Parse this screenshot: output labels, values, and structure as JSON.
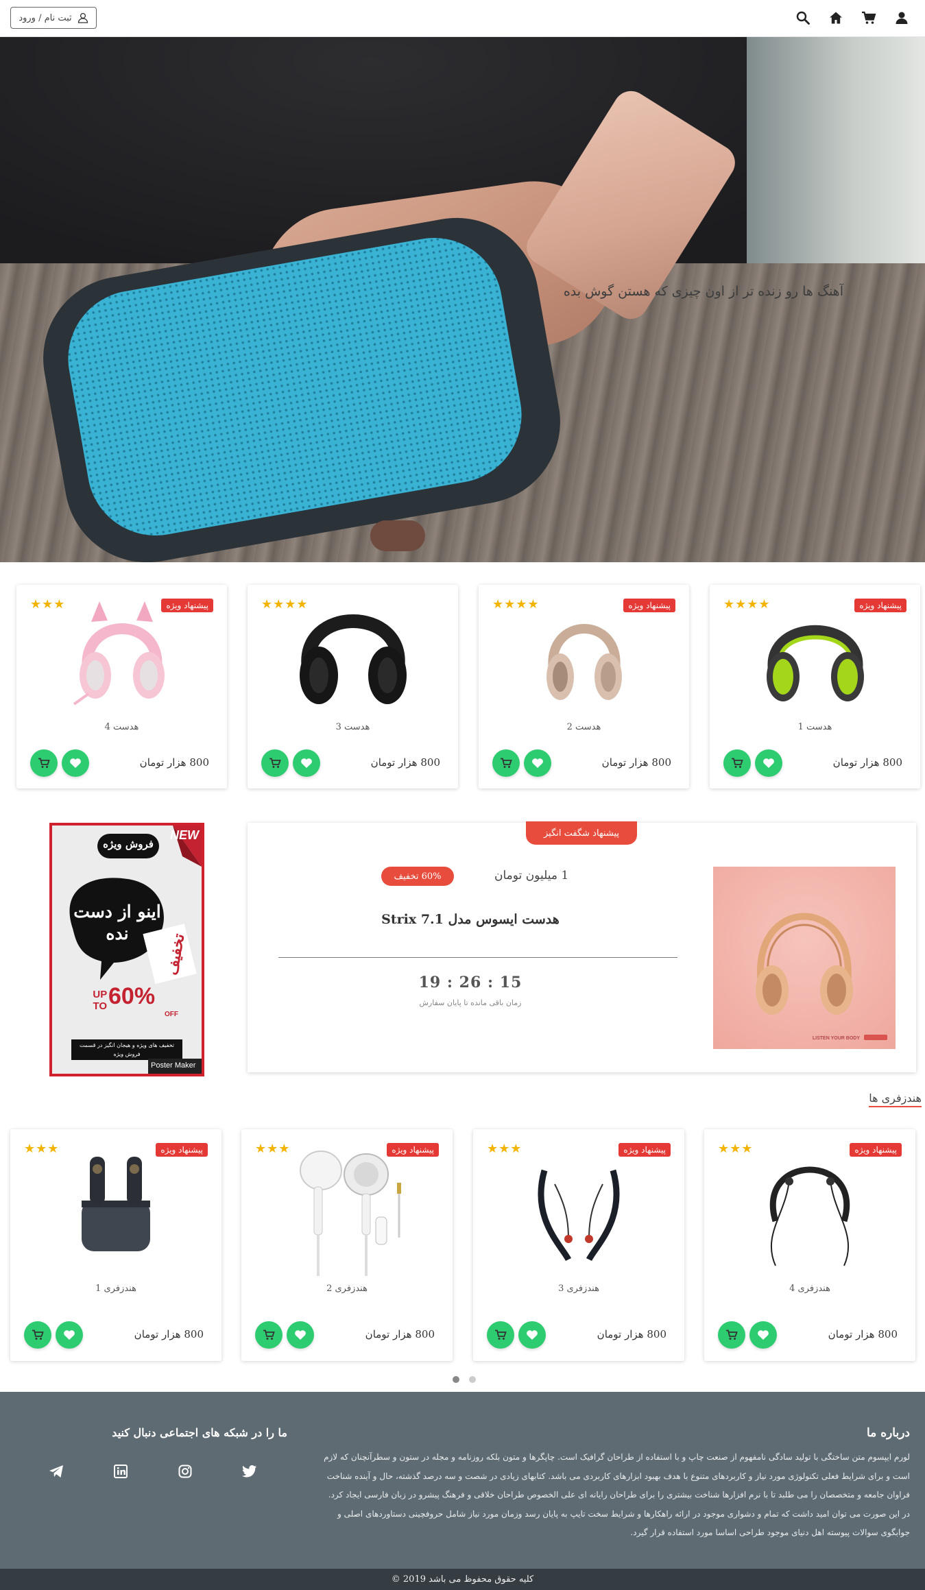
{
  "header": {
    "login_label": "ثبت نام / ورود",
    "icons": [
      "user-icon",
      "cart-icon",
      "home-icon",
      "search-icon"
    ]
  },
  "hero": {
    "caption": "آهنگ ها رو زنده تر از اون چیزی که هستن گوش بده",
    "slide_count": 3
  },
  "featured_products": [
    {
      "name": "هدست 1",
      "price": "800 هزار تومان",
      "badge": "پیشنهاد ویژه",
      "stars": 4
    },
    {
      "name": "هدست 2",
      "price": "800 هزار تومان",
      "badge": "پیشنهاد ویژه",
      "stars": 4
    },
    {
      "name": "هدست 3",
      "price": "800 هزار تومان",
      "badge": "",
      "stars": 4
    },
    {
      "name": "هدست 4",
      "price": "800 هزار تومان",
      "badge": "پیشنهاد ویژه",
      "stars": 3
    }
  ],
  "special_offer": {
    "ribbon": "پیشنهاد شگفت انگیز",
    "price": "1 میلیون تومان",
    "discount": "60% تخفیف",
    "title": "هدست ایسوس مدل Strix 7.1",
    "timer": "19 : 26 : 15",
    "timer_label": "زمان باقی مانده تا پایان سفارش",
    "image_caption": "LISTEN YOUR BODY"
  },
  "poster": {
    "tag": "NEW",
    "headline": "فروش ویژه",
    "bubble": "اینو از دست نده",
    "label": "تخفیف",
    "up_to": "UP TO",
    "percent": "60%",
    "off": "OFF",
    "footer": "تخفیف های ویژه و هیجان انگیز در قسمت فروش ویژه",
    "watermark": "Poster Maker"
  },
  "earphones": {
    "title": "هندزفری ها",
    "items": [
      {
        "name": "هندزفری 4",
        "price": "800 هزار تومان",
        "badge": "پیشنهاد ویژه",
        "stars": 3
      },
      {
        "name": "هندزفری 3",
        "price": "800 هزار تومان",
        "badge": "پیشنهاد ویژه",
        "stars": 3
      },
      {
        "name": "هندزفری 2",
        "price": "800 هزار تومان",
        "badge": "پیشنهاد ویژه",
        "stars": 3
      },
      {
        "name": "هندزفری 1",
        "price": "800 هزار تومان",
        "badge": "پیشنهاد ویژه",
        "stars": 3
      }
    ]
  },
  "footer": {
    "about_title": "درباره ما",
    "about_text": "لورم ایپسوم متن ساختگی با تولید سادگی نامفهوم از صنعت چاپ و با استفاده از طراحان گرافیک است. چاپگرها و متون بلکه روزنامه و مجله در ستون و سطرآنچنان که لازم است و برای شرایط فعلی تکنولوژی مورد نیاز و کاربردهای متنوع با هدف بهبود ابزارهای کاربردی می باشد. کتابهای زیادی در شصت و سه درصد گذشته، حال و آینده شناخت فراوان جامعه و متخصصان را می طلبد تا با نرم افزارها شناخت بیشتری را برای طراحان رایانه ای علی الخصوص طراحان خلاقی و فرهنگ پیشرو در زبان فارسی ایجاد کرد. در این صورت می توان امید داشت که تمام و دشواری موجود در ارائه راهکارها و شرایط سخت تایپ به پایان رسد وزمان مورد نیاز شامل حروفچینی دستاوردهای اصلی و جوابگوی سوالات پیوسته اهل دنیای موجود طراحی اساسا مورد استفاده قرار گیرد.",
    "social_title": "ما را در شبکه های اجتماعی دنبال کنید",
    "social_icons": [
      "twitter-icon",
      "instagram-icon",
      "linkedin-icon",
      "telegram-icon"
    ],
    "copyright": "کلیه حقوق محفوظ می باشد 2019 ©"
  },
  "colors": {
    "accent_red": "#e74c3c",
    "accent_green": "#2ecc71",
    "star": "#f2b400",
    "footer_bg": "#5f6b72",
    "copyright_bg": "#363d42"
  }
}
